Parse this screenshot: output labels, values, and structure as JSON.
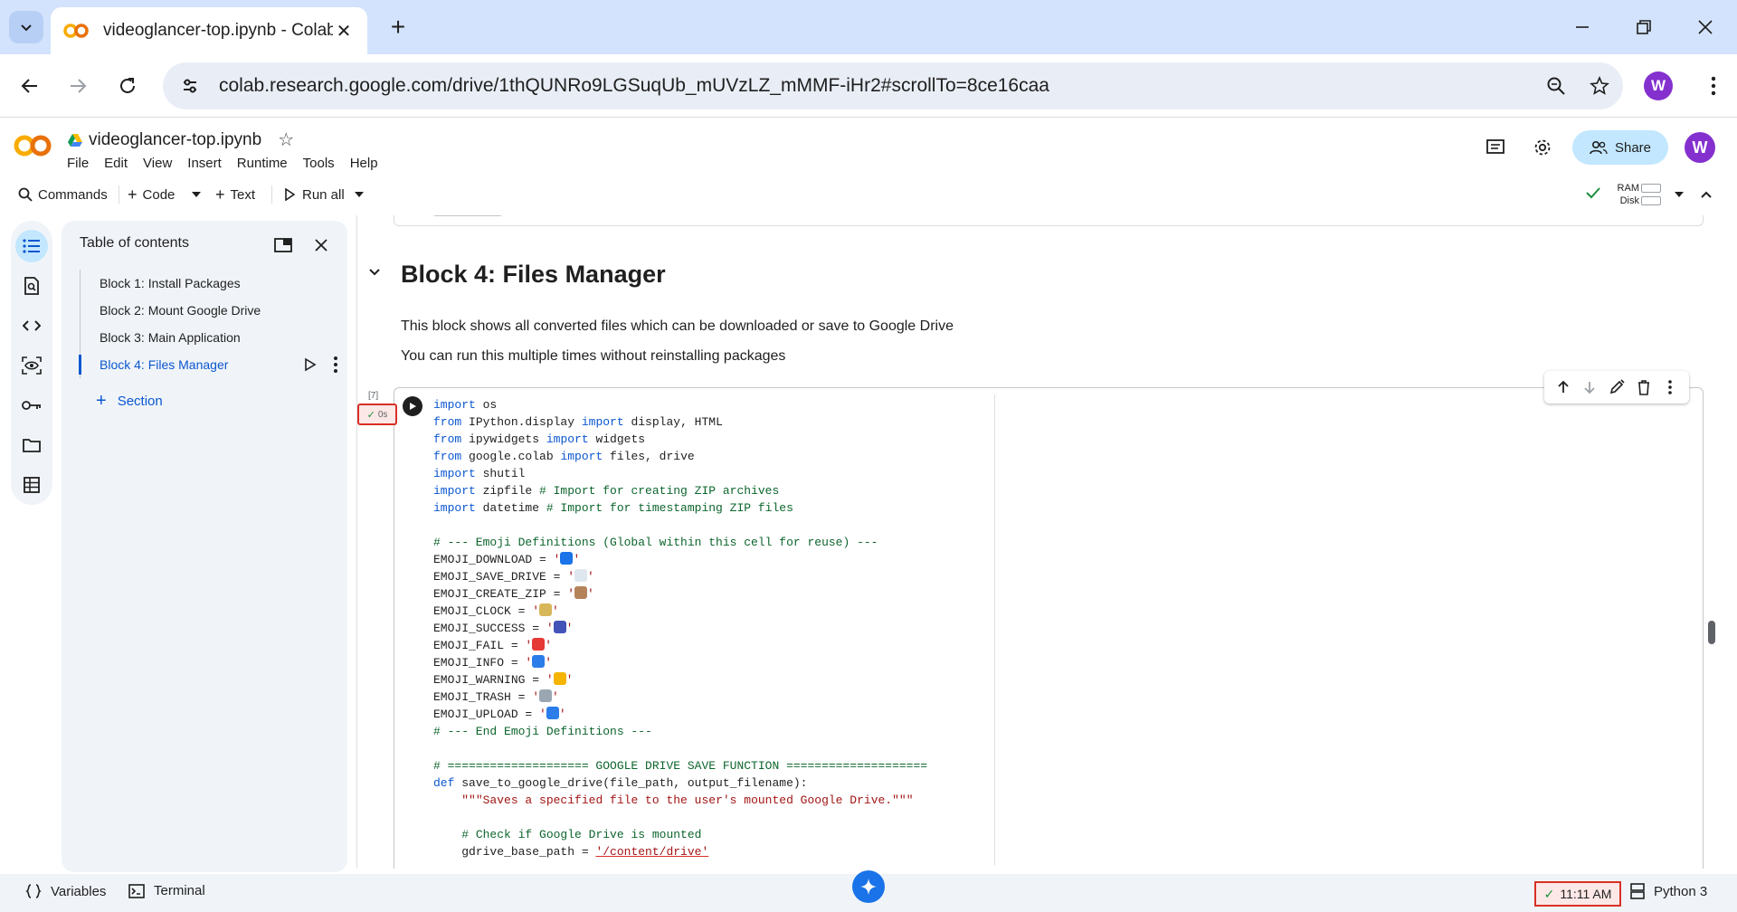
{
  "browser": {
    "tab_title": "videoglancer-top.ipynb - Colab",
    "url": "colab.research.google.com/drive/1thQUNRo9LGSuqUb_mUVzLZ_mMMF-iHr2#scrollTo=8ce16caa",
    "profile_initial": "W"
  },
  "colab": {
    "notebook_name": "videoglancer-top.ipynb",
    "menu": [
      "File",
      "Edit",
      "View",
      "Insert",
      "Runtime",
      "Tools",
      "Help"
    ],
    "share_label": "Share",
    "avatar_initial": "W",
    "toolbar": {
      "commands": "Commands",
      "code": "Code",
      "text": "Text",
      "run_all": "Run all"
    },
    "resources": {
      "ram": "RAM",
      "disk": "Disk"
    }
  },
  "toc": {
    "title": "Table of contents",
    "items": [
      "Block 1: Install Packages",
      "Block 2: Mount Google Drive",
      "Block 3: Main Application",
      "Block 4: Files Manager"
    ],
    "active_index": 3,
    "add_section": "Section"
  },
  "notebook": {
    "heading": "Block 4: Files Manager",
    "paragraphs": [
      "This block shows all converted files which can be downloaded or save to Google Drive",
      "You can run this multiple times without reinstalling packages"
    ],
    "cell": {
      "exec_count": "[7]",
      "status": "0s",
      "code": [
        [
          [
            "kw",
            "import"
          ],
          [
            "t",
            " os"
          ]
        ],
        [
          [
            "kw",
            "from"
          ],
          [
            "t",
            " IPython.display "
          ],
          [
            "kw",
            "import"
          ],
          [
            "t",
            " display, HTML"
          ]
        ],
        [
          [
            "kw",
            "from"
          ],
          [
            "t",
            " ipywidgets "
          ],
          [
            "kw",
            "import"
          ],
          [
            "t",
            " widgets"
          ]
        ],
        [
          [
            "kw",
            "from"
          ],
          [
            "t",
            " google.colab "
          ],
          [
            "kw",
            "import"
          ],
          [
            "t",
            " files, drive"
          ]
        ],
        [
          [
            "kw",
            "import"
          ],
          [
            "t",
            " shutil"
          ]
        ],
        [
          [
            "kw",
            "import"
          ],
          [
            "t",
            " zipfile "
          ],
          [
            "cm",
            "# Import for creating ZIP archives"
          ]
        ],
        [
          [
            "kw",
            "import"
          ],
          [
            "t",
            " datetime "
          ],
          [
            "cm",
            "# Import for timestamping ZIP files"
          ]
        ],
        [],
        [
          [
            "cm",
            "# --- Emoji Definitions (Global within this cell for reuse) ---"
          ]
        ],
        [
          [
            "t",
            "EMOJI_DOWNLOAD = "
          ],
          [
            "st",
            "'"
          ],
          [
            "em",
            "#1a73e8"
          ],
          [
            "st",
            "'"
          ]
        ],
        [
          [
            "t",
            "EMOJI_SAVE_DRIVE = "
          ],
          [
            "st",
            "'"
          ],
          [
            "em",
            "#dfe7ee"
          ],
          [
            "st",
            "'"
          ]
        ],
        [
          [
            "t",
            "EMOJI_CREATE_ZIP = "
          ],
          [
            "st",
            "'"
          ],
          [
            "em",
            "#b5835a"
          ],
          [
            "st",
            "'"
          ]
        ],
        [
          [
            "t",
            "EMOJI_CLOCK = "
          ],
          [
            "st",
            "'"
          ],
          [
            "em",
            "#d8b75b"
          ],
          [
            "st",
            "'"
          ]
        ],
        [
          [
            "t",
            "EMOJI_SUCCESS = "
          ],
          [
            "st",
            "'"
          ],
          [
            "em",
            "#4354b8"
          ],
          [
            "st",
            "'"
          ]
        ],
        [
          [
            "t",
            "EMOJI_FAIL = "
          ],
          [
            "st",
            "'"
          ],
          [
            "em",
            "#e53935"
          ],
          [
            "st",
            "'"
          ]
        ],
        [
          [
            "t",
            "EMOJI_INFO = "
          ],
          [
            "st",
            "'"
          ],
          [
            "em",
            "#2b7de9"
          ],
          [
            "st",
            "'"
          ]
        ],
        [
          [
            "t",
            "EMOJI_WARNING = "
          ],
          [
            "st",
            "'"
          ],
          [
            "em",
            "#f4b400"
          ],
          [
            "st",
            "'"
          ]
        ],
        [
          [
            "t",
            "EMOJI_TRASH = "
          ],
          [
            "st",
            "'"
          ],
          [
            "em",
            "#9aa7b3"
          ],
          [
            "st",
            "'"
          ]
        ],
        [
          [
            "t",
            "EMOJI_UPLOAD = "
          ],
          [
            "st",
            "'"
          ],
          [
            "em",
            "#2b7de9"
          ],
          [
            "st",
            "'"
          ]
        ],
        [
          [
            "cm",
            "# --- End Emoji Definitions ---"
          ]
        ],
        [],
        [
          [
            "cm",
            "# ==================== GOOGLE DRIVE SAVE FUNCTION ===================="
          ]
        ],
        [
          [
            "kw",
            "def"
          ],
          [
            "t",
            " save_to_google_drive(file_path, output_filename):"
          ]
        ],
        [
          [
            "t",
            "    "
          ],
          [
            "st",
            "\"\"\"Saves a specified file to the user's mounted Google Drive.\"\"\""
          ]
        ],
        [],
        [
          [
            "t",
            "    "
          ],
          [
            "cm",
            "# Check if Google Drive is mounted"
          ]
        ],
        [
          [
            "t",
            "    gdrive_base_path = "
          ],
          [
            "su",
            "'/content/drive'"
          ]
        ]
      ]
    }
  },
  "statusbar": {
    "variables": "Variables",
    "terminal": "Terminal",
    "time": "11:11 AM",
    "kernel": "Python 3"
  }
}
